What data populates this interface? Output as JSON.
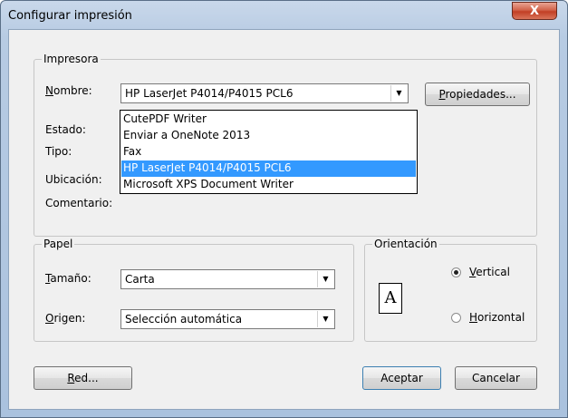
{
  "window": {
    "title": "Configurar impresión",
    "close_glyph": "X"
  },
  "printer_group": {
    "label": "Impresora",
    "name_label_u": "N",
    "name_label_rest": "ombre:",
    "selected": "HP LaserJet P4014/P4015 PCL6",
    "properties_button_u": "P",
    "properties_button_rest": "ropiedades...",
    "status_label": "Estado:",
    "type_label": "Tipo:",
    "location_label": "Ubicación:",
    "comment_label": "Comentario:",
    "dropdown_items": [
      "CutePDF Writer",
      "Enviar a OneNote 2013",
      "Fax",
      "HP LaserJet P4014/P4015 PCL6",
      "Microsoft XPS Document Writer"
    ],
    "highlighted_index": 3
  },
  "paper_group": {
    "label": "Papel",
    "size_label_u": "T",
    "size_label_rest": "amaño:",
    "size_value": "Carta",
    "source_label_u": "O",
    "source_label_rest": "rigen:",
    "source_value": "Selección automática"
  },
  "orientation_group": {
    "label": "Orientación",
    "icon_letter": "A",
    "vertical_u": "V",
    "vertical_rest": "ertical",
    "horizontal_u": "H",
    "horizontal_rest": "orizontal",
    "selected": "Vertical"
  },
  "buttons": {
    "network_u": "R",
    "network_rest": "ed...",
    "ok": "Aceptar",
    "cancel": "Cancelar"
  },
  "icons": {
    "close": "close-icon",
    "dropdown": "chevron-down-icon",
    "orientation": "portrait-page-icon"
  },
  "colors": {
    "selection": "#3399ff",
    "close_button": "#c23f25",
    "dialog_background": "#f0f0f0"
  }
}
